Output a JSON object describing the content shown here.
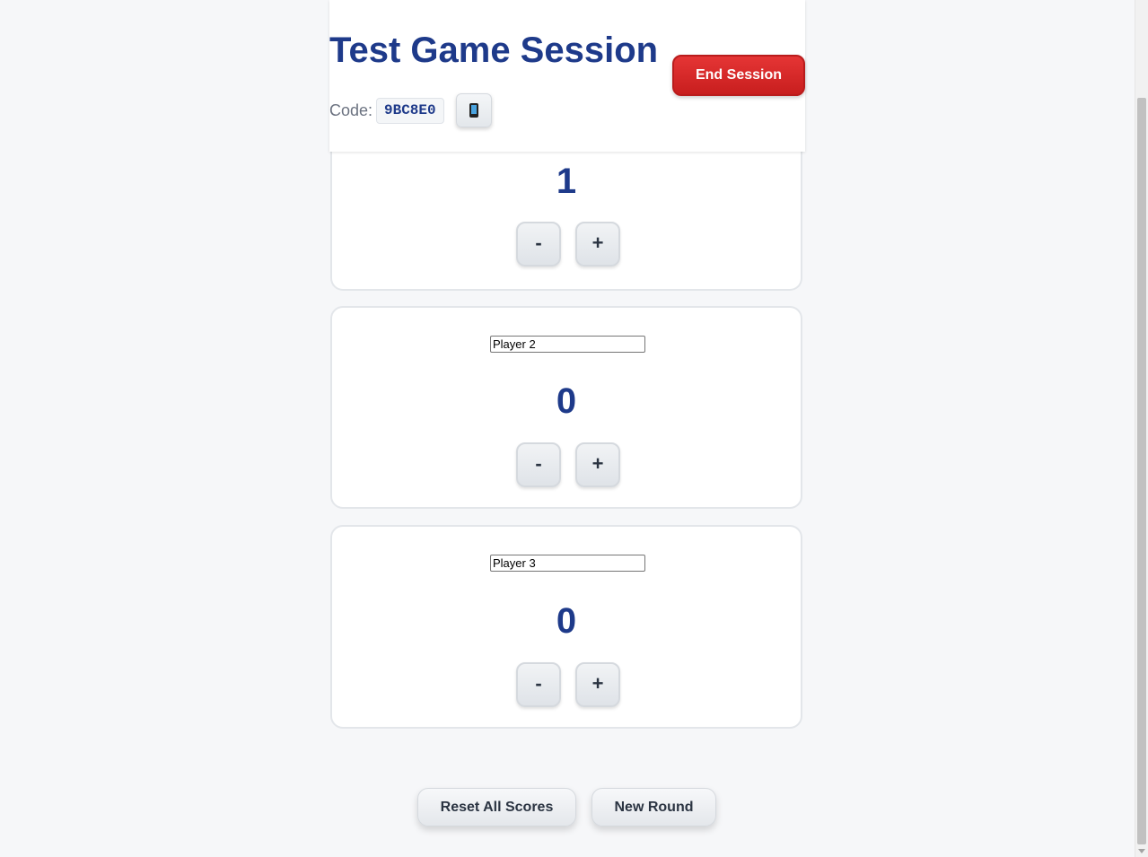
{
  "header": {
    "title": "Test Game Session",
    "code_label": "Code:",
    "code_value": "9BC8E0",
    "end_session_label": "End Session"
  },
  "players": [
    {
      "name": "",
      "score": "1",
      "minus_label": "-",
      "plus_label": "+"
    },
    {
      "name": "Player 2",
      "score": "0",
      "minus_label": "-",
      "plus_label": "+"
    },
    {
      "name": "Player 3",
      "score": "0",
      "minus_label": "-",
      "plus_label": "+"
    }
  ],
  "footer": {
    "reset_label": "Reset All Scores",
    "new_round_label": "New Round"
  },
  "icons": {
    "phone": "mobile-phone-icon"
  },
  "colors": {
    "accent": "#1e3a8a",
    "danger": "#dc2626",
    "background": "#f6f7f9"
  }
}
